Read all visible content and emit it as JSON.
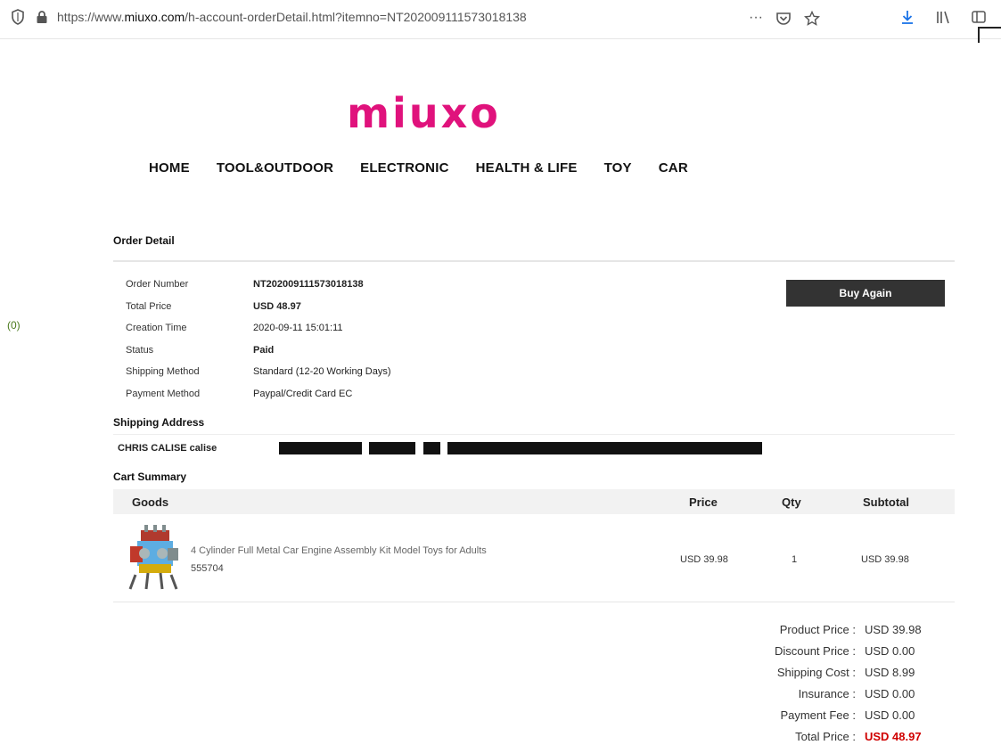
{
  "browser": {
    "url_prefix": "https://www.",
    "url_domain": "miuxo.com",
    "url_path": "/h-account-orderDetail.html?itemno=NT202009111573018138",
    "more_label": "···"
  },
  "site": {
    "logo": "miuxo",
    "nav": [
      "HOME",
      "TOOL&OUTDOOR",
      "ELECTRONIC",
      "HEALTH & LIFE",
      "TOY",
      "CAR"
    ]
  },
  "side_count": "(0)",
  "order": {
    "title": "Order Detail",
    "fields": [
      {
        "label": "Order Number",
        "value": "NT202009111573018138"
      },
      {
        "label": "Total Price",
        "value": "USD 48.97"
      },
      {
        "label": "Creation Time",
        "value": "2020-09-11 15:01:11"
      },
      {
        "label": "Status",
        "value": "Paid"
      },
      {
        "label": "Shipping Method",
        "value": "Standard (12-20 Working Days)"
      },
      {
        "label": "Payment Method",
        "value": "Paypal/Credit Card EC"
      }
    ],
    "buy_again_label": "Buy Again"
  },
  "shipping": {
    "title": "Shipping Address",
    "name": "CHRIS CALISE calise"
  },
  "cart": {
    "title": "Cart Summary",
    "headers": {
      "goods": "Goods",
      "price": "Price",
      "qty": "Qty",
      "subtotal": "Subtotal"
    },
    "items": [
      {
        "name": "4 Cylinder Full Metal Car Engine Assembly Kit Model Toys for Adults",
        "sku": "555704",
        "price": "USD 39.98",
        "qty": "1",
        "subtotal": "USD 39.98"
      }
    ]
  },
  "totals": [
    {
      "label": "Product Price :",
      "value": "USD 39.98"
    },
    {
      "label": "Discount Price :",
      "value": "USD 0.00"
    },
    {
      "label": "Shipping Cost :",
      "value": "USD 8.99"
    },
    {
      "label": "Insurance :",
      "value": "USD 0.00"
    },
    {
      "label": "Payment Fee :",
      "value": "USD 0.00"
    },
    {
      "label": "Total Price :",
      "value": "USD 48.97"
    }
  ],
  "colors": {
    "brand": "#e0127c",
    "total": "#d00000",
    "button": "#333333"
  }
}
